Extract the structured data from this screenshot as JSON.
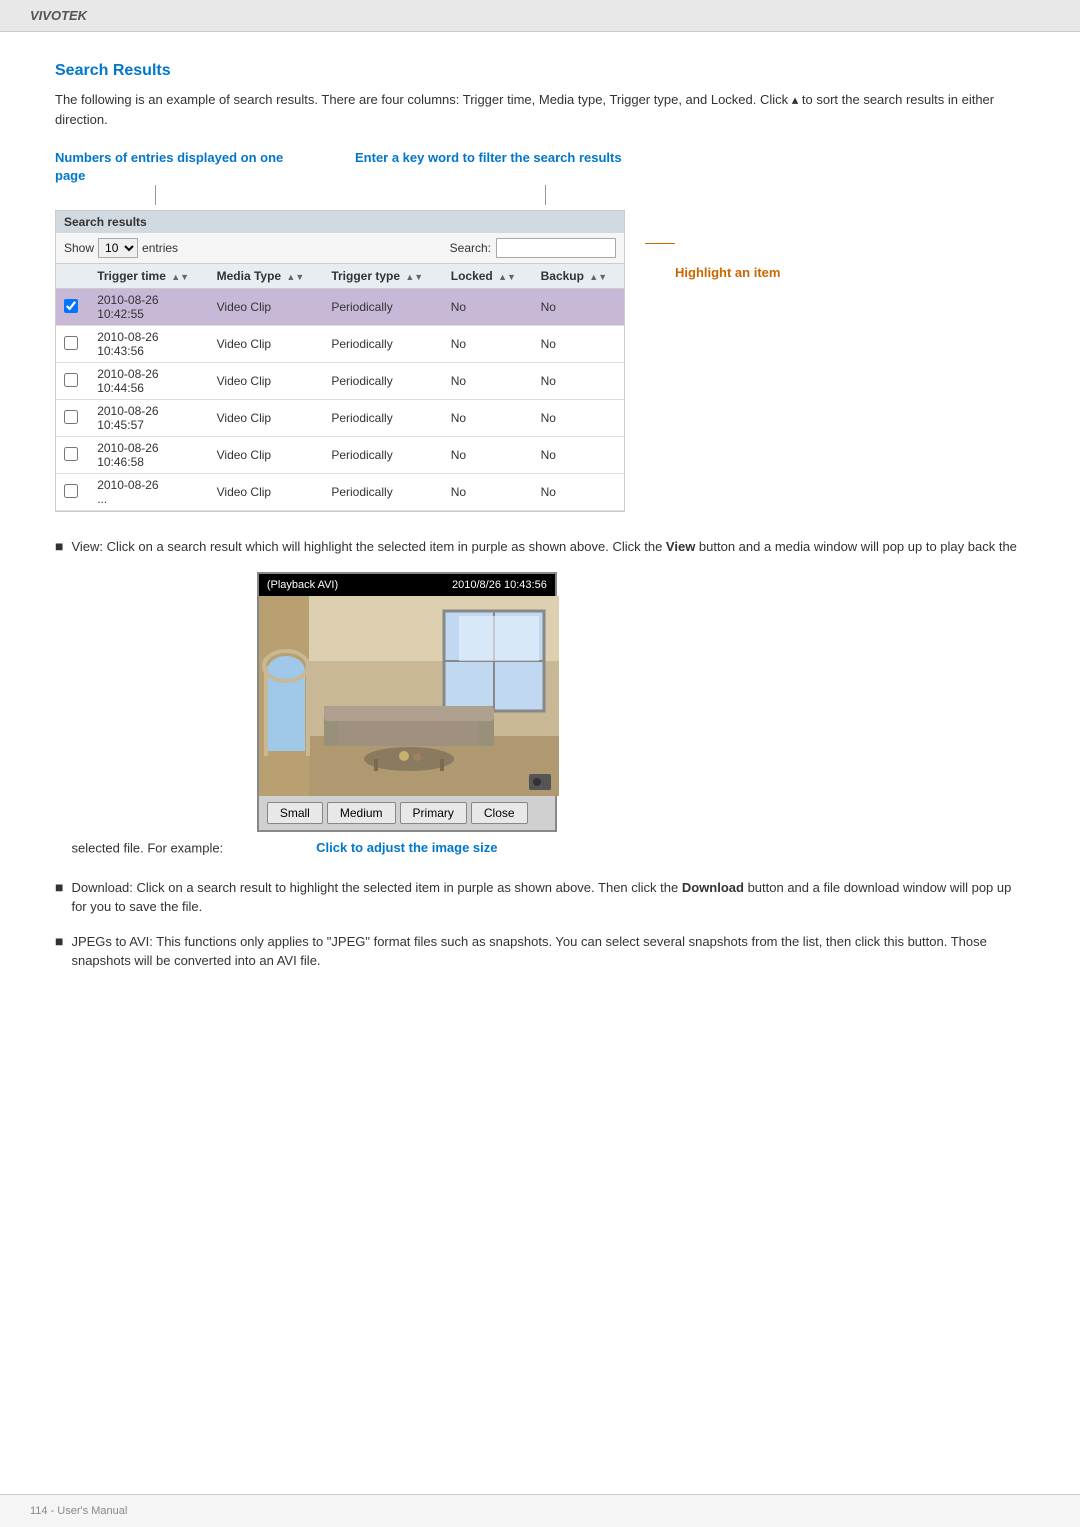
{
  "brand": "VIVOTEK",
  "header": {
    "title": "Search Results",
    "intro": "The following is an example of search results. There are four columns: Trigger time, Media type, Trigger type, and Locked. Click  to sort the search results in either direction."
  },
  "annotations": {
    "entries_label": "Numbers of entries displayed on one page",
    "filter_label": "Enter a key word to filter the search results",
    "highlight_label": "Highlight an item"
  },
  "table": {
    "header_label": "Search results",
    "show_label": "Show",
    "entries_label": "entries",
    "show_value": "10",
    "search_label": "Search:",
    "search_placeholder": "",
    "columns": [
      "",
      "Trigger time",
      "Media Type",
      "Trigger type",
      "Locked",
      "Backup"
    ],
    "rows": [
      {
        "highlighted": true,
        "trigger_time": "2010-08-26\n10:42:55",
        "media_type": "Video Clip",
        "trigger_type": "Periodically",
        "locked": "No",
        "backup": "No"
      },
      {
        "highlighted": false,
        "trigger_time": "2010-08-26\n10:43:56",
        "media_type": "Video Clip",
        "trigger_type": "Periodically",
        "locked": "No",
        "backup": "No"
      },
      {
        "highlighted": false,
        "trigger_time": "2010-08-26\n10:44:56",
        "media_type": "Video Clip",
        "trigger_type": "Periodically",
        "locked": "No",
        "backup": "No"
      },
      {
        "highlighted": false,
        "trigger_time": "2010-08-26\n10:45:57",
        "media_type": "Video Clip",
        "trigger_type": "Periodically",
        "locked": "No",
        "backup": "No"
      },
      {
        "highlighted": false,
        "trigger_time": "2010-08-26\n10:46:58",
        "media_type": "Video Clip",
        "trigger_type": "Periodically",
        "locked": "No",
        "backup": "No"
      },
      {
        "highlighted": false,
        "trigger_time": "2010-08-26\n...",
        "media_type": "Video Clip",
        "trigger_type": "Periodically",
        "locked": "No",
        "backup": "No"
      }
    ]
  },
  "playback": {
    "title_left": "(Playback AVI)",
    "title_right": "2010/8/26 10:43:56",
    "buttons": [
      "Small",
      "Medium",
      "Primary",
      "Close"
    ],
    "caption": "Click to adjust the image size"
  },
  "bullets": [
    {
      "id": "view",
      "text_start": "View: Click on a search result which will highlight the selected item in purple as shown above. Click the ",
      "bold": "View",
      "text_end": " button and a media window will pop up to play back the selected file.\nFor example:"
    },
    {
      "id": "download",
      "text_start": "Download: Click on a search result to highlight the selected item in purple as shown above. Then click the ",
      "bold": "Download",
      "text_end": " button and a file download window will pop up for you to save the file."
    },
    {
      "id": "jpegs",
      "text_start": "JPEGs to AVI: This functions only applies to \"JPEG\" format files such as snapshots. You can select several snapshots from the list, then click this button. Those snapshots will be converted into an AVI file."
    }
  ],
  "footer": {
    "text": "114 - User's Manual"
  }
}
